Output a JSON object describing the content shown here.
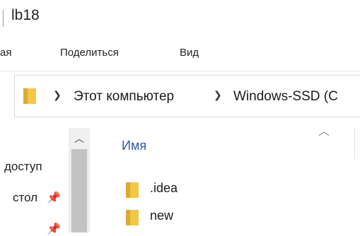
{
  "window": {
    "title": "lb18"
  },
  "ribbon": {
    "tabs": [
      {
        "label": "ая"
      },
      {
        "label": "Поделиться"
      },
      {
        "label": "Вид"
      }
    ]
  },
  "address": {
    "breadcrumbs": [
      {
        "label": "Этот компьютер"
      },
      {
        "label": "Windows-SSD (С"
      }
    ]
  },
  "nav": {
    "items": [
      {
        "label": "доступ"
      },
      {
        "label": "стол"
      },
      {
        "label": ""
      }
    ]
  },
  "content": {
    "column_header": "Имя",
    "files": [
      {
        "name": ".idea"
      },
      {
        "name": "new"
      }
    ]
  },
  "colors": {
    "folder": "#f2c744",
    "folder_dark": "#dcaa2e",
    "header_text": "#2d5a9c",
    "scroll_thumb": "#c3c3c3"
  }
}
